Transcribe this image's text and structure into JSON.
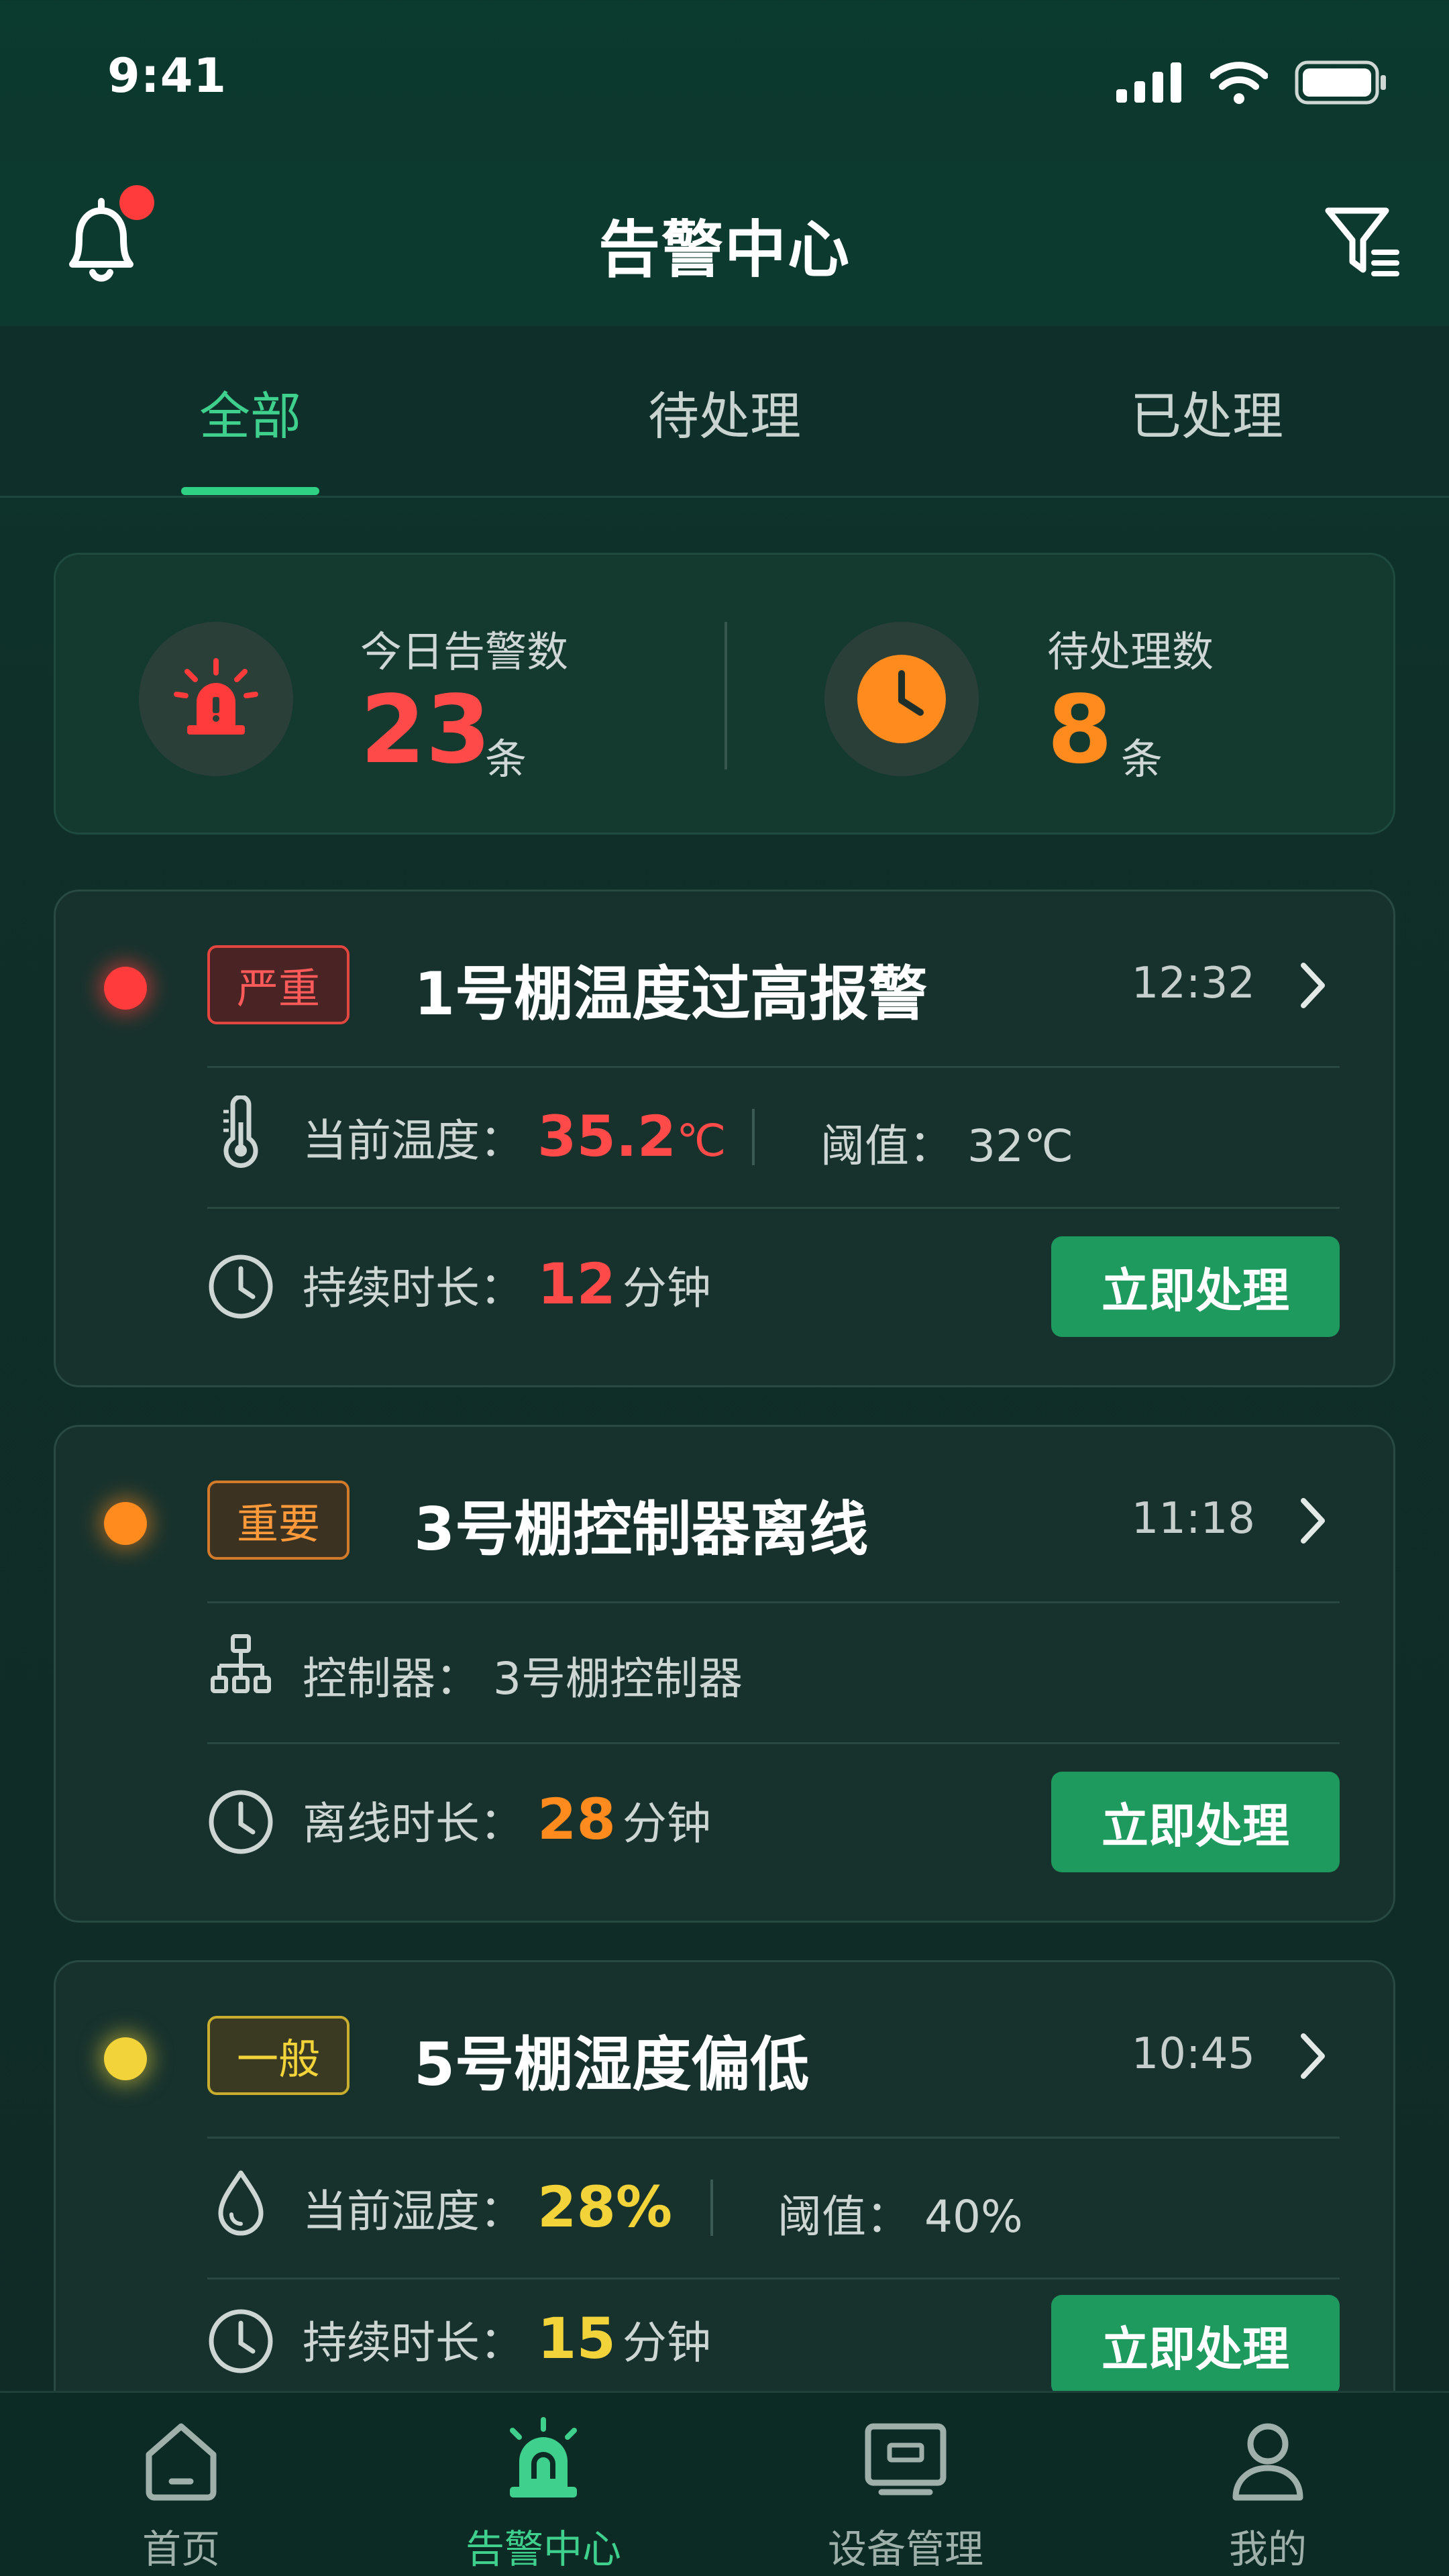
{
  "status_bar": {
    "time": "9:41"
  },
  "header": {
    "title": "告警中心"
  },
  "tabs": [
    {
      "label": "全部",
      "active": true
    },
    {
      "label": "待处理",
      "active": false
    },
    {
      "label": "已处理",
      "active": false
    }
  ],
  "summary": {
    "today": {
      "label": "今日告警数",
      "value": "23",
      "unit": "条"
    },
    "pending": {
      "label": "待处理数",
      "value": "8",
      "unit": "条"
    }
  },
  "alerts": [
    {
      "level": "严重",
      "title": "1号棚温度过高报警",
      "time": "12:32",
      "row1_label": "当前温度：",
      "row1_value": "35.2",
      "row1_unit": "℃",
      "row1_extra": "阈值：  32℃",
      "row2_label": "持续时长：",
      "row2_value": "12",
      "row2_unit": "分钟",
      "action": "立即处理",
      "color": "#ff3b3b"
    },
    {
      "level": "重要",
      "title": "3号棚控制器离线",
      "time": "11:18",
      "row1_label": "控制器：",
      "row1_value": "3号棚控制器",
      "row2_label": "离线时长：",
      "row2_value": "28",
      "row2_unit": "分钟",
      "action": "立即处理",
      "color": "#ff8a1e"
    },
    {
      "level": "一般",
      "title": "5号棚湿度偏低",
      "time": "10:45",
      "row1_label": "当前湿度：",
      "row1_value": "28%",
      "row1_extra": "阈值：  40%",
      "row2_label": "持续时长：",
      "row2_value": "15",
      "row2_unit": "分钟",
      "action": "立即处理",
      "color": "#f2d33a"
    }
  ],
  "bottom_nav": [
    {
      "label": "首页",
      "icon": "home-icon",
      "active": false
    },
    {
      "label": "告警中心",
      "icon": "alarm-icon",
      "active": true
    },
    {
      "label": "设备管理",
      "icon": "device-icon",
      "active": false
    },
    {
      "label": "我的",
      "icon": "user-icon",
      "active": false
    }
  ],
  "colors": {
    "accent": "#3ed08c",
    "button": "#1e9a5f",
    "critical": "#ff3b3b",
    "important": "#ff8a1e",
    "normal": "#f2d33a"
  }
}
